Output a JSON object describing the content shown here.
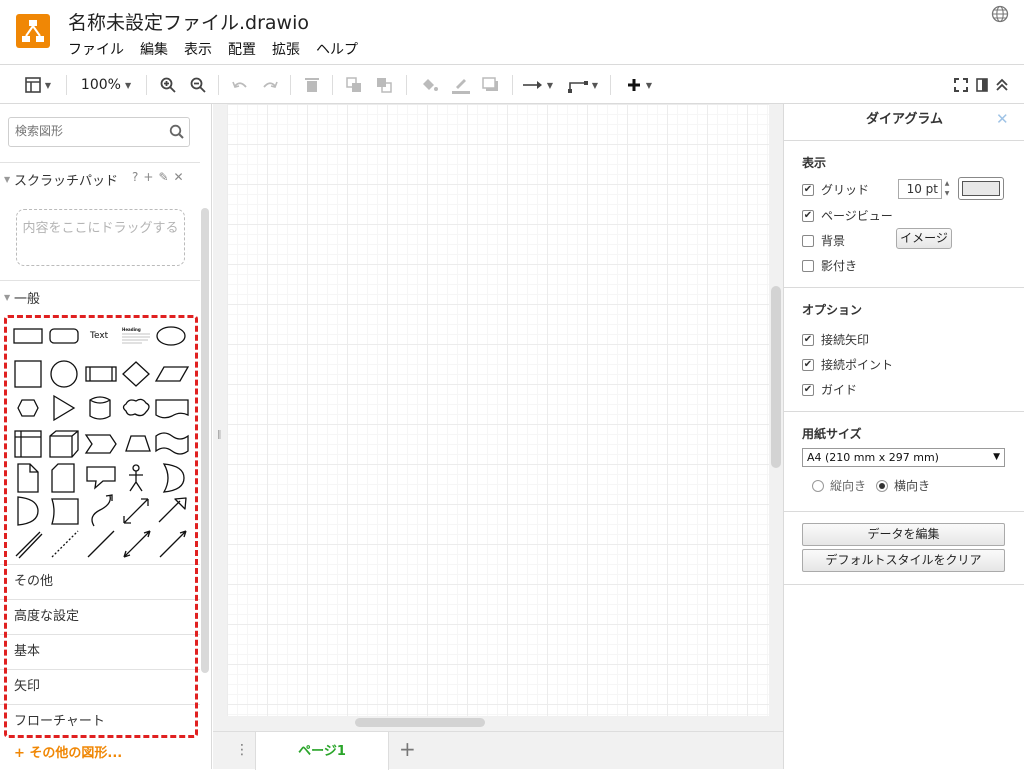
{
  "app": {
    "title": "名称未設定ファイル.drawio",
    "menu": [
      "ファイル",
      "編集",
      "表示",
      "配置",
      "拡張",
      "ヘルプ"
    ]
  },
  "toolbar": {
    "zoom": "100%"
  },
  "sidebar": {
    "search_placeholder": "検索図形",
    "scratchpad": {
      "title": "スクラッチパッド",
      "help": "?",
      "drop_hint": "内容をここにドラッグする"
    },
    "general": {
      "title": "一般",
      "text_shape": "Text",
      "heading_shape": "Heading"
    },
    "categories": [
      "その他",
      "高度な設定",
      "基本",
      "矢印",
      "フローチャート"
    ],
    "more_shapes": "その他の図形..."
  },
  "pages": {
    "active": "ページ1"
  },
  "panel": {
    "title": "ダイアグラム",
    "view": {
      "title": "表示",
      "grid": "グリッド",
      "grid_size": "10 pt",
      "page_view": "ページビュー",
      "background": "背景",
      "image_button": "イメージ",
      "shadow": "影付き"
    },
    "options": {
      "title": "オプション",
      "connection_arrows": "接続矢印",
      "connection_points": "接続ポイント",
      "guides": "ガイド"
    },
    "paper": {
      "title": "用紙サイズ",
      "size": "A4 (210 mm x 297 mm)",
      "portrait": "縦向き",
      "landscape": "横向き"
    },
    "edit_data": "データを編集",
    "clear_style": "デフォルトスタイルをクリア"
  }
}
